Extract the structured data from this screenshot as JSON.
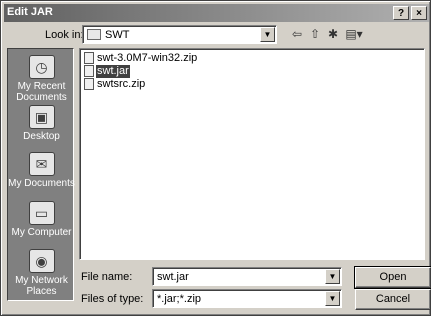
{
  "window": {
    "title": "Edit JAR",
    "help_glyph": "?",
    "close_glyph": "×"
  },
  "lookin": {
    "label": "Look in:",
    "value": "SWT",
    "dropdown_glyph": "▼"
  },
  "toolbar": {
    "back_glyph": "⇦",
    "up_glyph": "⇧",
    "new_folder_glyph": "✱",
    "views_glyph": "▤▾"
  },
  "places": [
    {
      "label": "My Recent Documents",
      "icon": "recent-docs-icon",
      "glyph": "◷"
    },
    {
      "label": "Desktop",
      "icon": "desktop-icon",
      "glyph": "▣"
    },
    {
      "label": "My Documents",
      "icon": "my-documents-icon",
      "glyph": "✉"
    },
    {
      "label": "My Computer",
      "icon": "my-computer-icon",
      "glyph": "▭"
    },
    {
      "label": "My Network Places",
      "icon": "network-places-icon",
      "glyph": "◉"
    }
  ],
  "files": [
    {
      "name": "swt-3.0M7-win32.zip",
      "selected": false
    },
    {
      "name": "swt.jar",
      "selected": true
    },
    {
      "name": "swtsrc.zip",
      "selected": false
    }
  ],
  "filename": {
    "label": "File name:",
    "value": "swt.jar"
  },
  "filetype": {
    "label": "Files of type:",
    "value": "*.jar;*.zip"
  },
  "buttons": {
    "open": "Open",
    "cancel": "Cancel"
  },
  "combo_arrow": "▼"
}
